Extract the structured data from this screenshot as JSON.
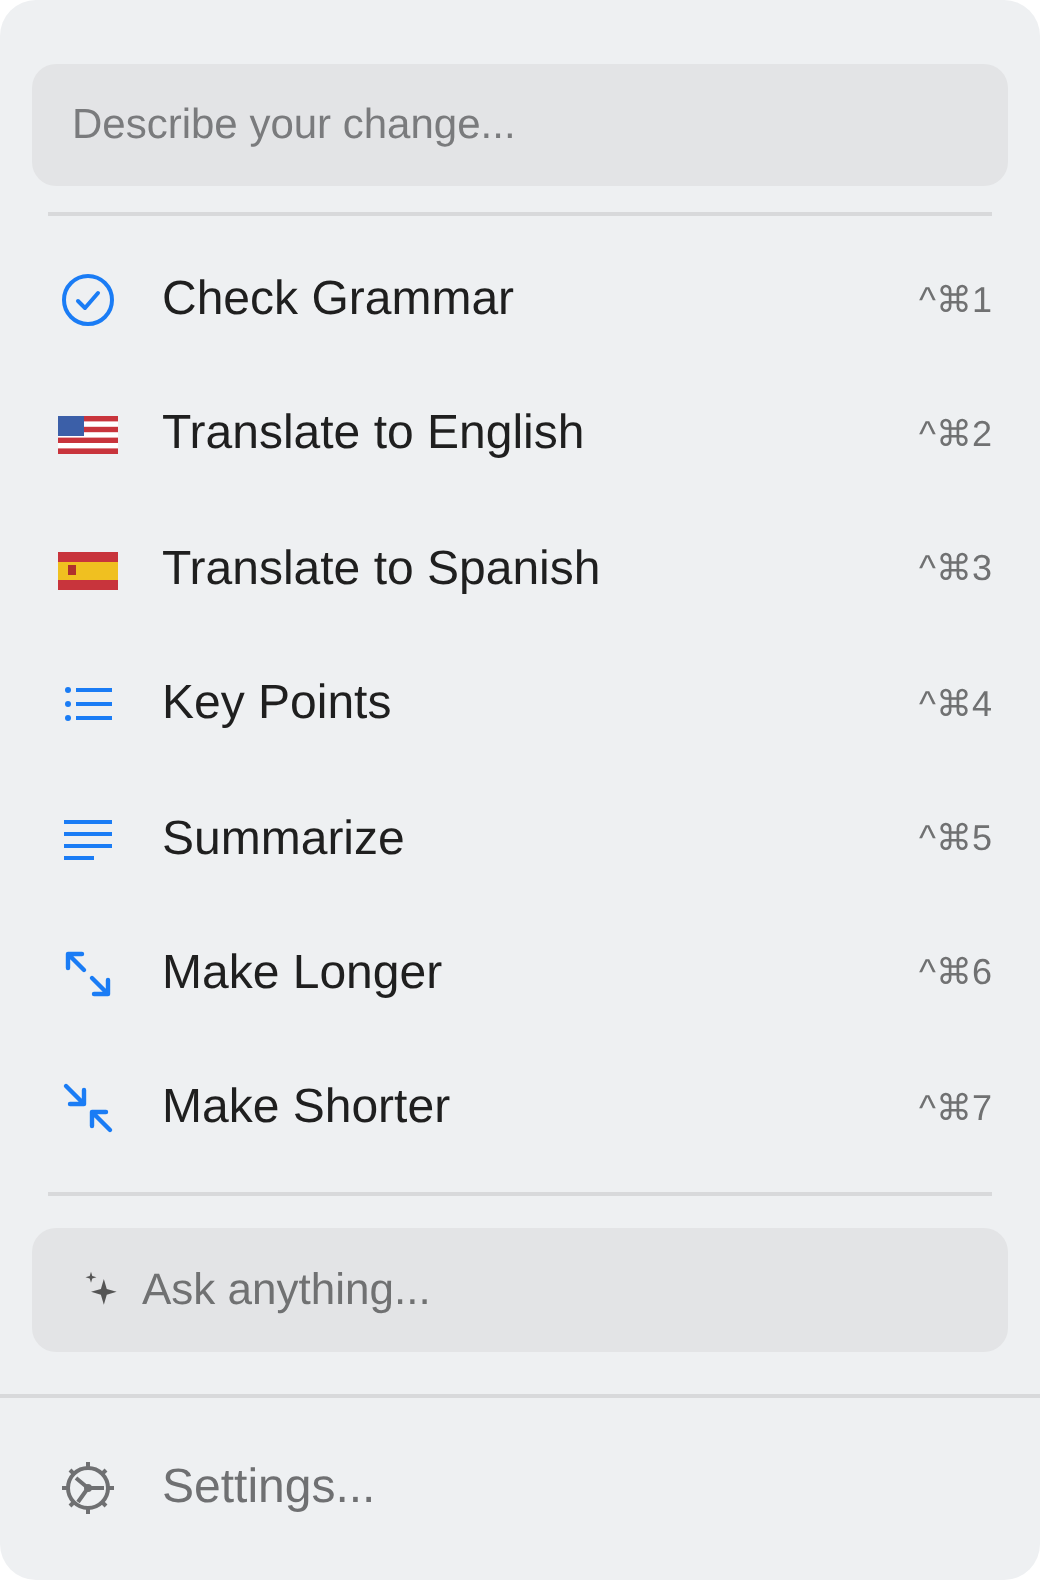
{
  "change_field": {
    "placeholder": "Describe your change..."
  },
  "actions": [
    {
      "kind": "check",
      "label": "Check Grammar",
      "shortcut": "^⌘1"
    },
    {
      "kind": "flag-us",
      "label": "Translate to English",
      "shortcut": "^⌘2"
    },
    {
      "kind": "flag-es",
      "label": "Translate to Spanish",
      "shortcut": "^⌘3"
    },
    {
      "kind": "list",
      "label": "Key Points",
      "shortcut": "^⌘4"
    },
    {
      "kind": "lines",
      "label": "Summarize",
      "shortcut": "^⌘5"
    },
    {
      "kind": "expand",
      "label": "Make Longer",
      "shortcut": "^⌘6"
    },
    {
      "kind": "collapse",
      "label": "Make Shorter",
      "shortcut": "^⌘7"
    }
  ],
  "ask_field": {
    "placeholder": "Ask anything..."
  },
  "settings": {
    "label": "Settings..."
  }
}
